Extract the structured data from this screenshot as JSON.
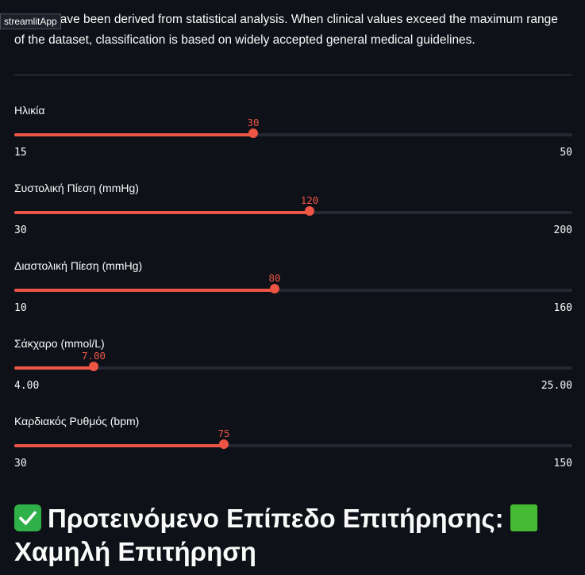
{
  "badge": "streamlitApp",
  "intro": "sholds have been derived from statistical analysis. When clinical values exceed the maximum range of the dataset, classification is based on widely accepted general medical guidelines.",
  "sliders": [
    {
      "label": "Ηλικία",
      "value": 30,
      "value_text": "30",
      "min": 15,
      "min_text": "15",
      "max": 50,
      "max_text": "50"
    },
    {
      "label": "Συστολική Πίεση (mmHg)",
      "value": 120,
      "value_text": "120",
      "min": 30,
      "min_text": "30",
      "max": 200,
      "max_text": "200"
    },
    {
      "label": "Διαστολική Πίεση (mmHg)",
      "value": 80,
      "value_text": "80",
      "min": 10,
      "min_text": "10",
      "max": 160,
      "max_text": "160"
    },
    {
      "label": "Σάκχαρο (mmol/L)",
      "value": 7.0,
      "value_text": "7.00",
      "min": 4.0,
      "min_text": "4.00",
      "max": 25.0,
      "max_text": "25.00"
    },
    {
      "label": "Καρδιακός Ρυθμός (bpm)",
      "value": 75,
      "value_text": "75",
      "min": 30,
      "min_text": "30",
      "max": 150,
      "max_text": "150"
    }
  ],
  "result": {
    "prefix": "Προτεινόμενο Επίπεδο Επιτήρησης:",
    "level": "Χαμηλή Επιτήρηση",
    "icons": [
      "check-mark-icon",
      "green-square-icon"
    ]
  },
  "colors": {
    "background": "#0e1117",
    "accent": "#ee5545",
    "track": "#262730",
    "text": "#fafafa"
  }
}
